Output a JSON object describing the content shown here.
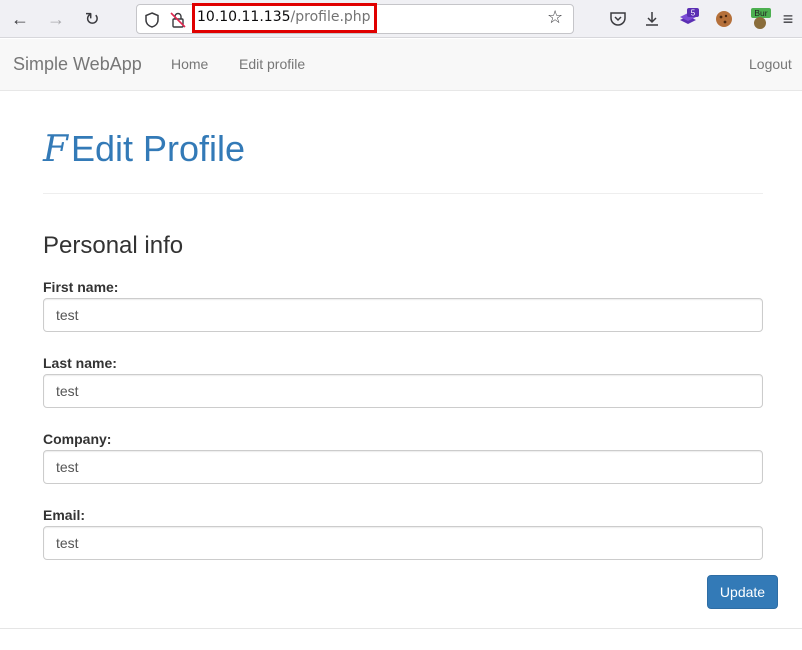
{
  "browser": {
    "back_label": "←",
    "forward_label": "→",
    "reload_label": "↻",
    "url_host": "10.10.11.135",
    "url_path": "/profile.php",
    "bookmark_star": "☆",
    "extension_badge": "5",
    "burp_label": "Bur",
    "menu_label": "≡"
  },
  "navbar": {
    "brand": "Simple WebApp",
    "links": [
      "Home",
      "Edit profile"
    ],
    "logout": "Logout"
  },
  "page": {
    "title_glyph": "F",
    "title": "Edit Profile",
    "section": "Personal info",
    "fields": [
      {
        "label": "First name:",
        "value": "test"
      },
      {
        "label": "Last name:",
        "value": "test"
      },
      {
        "label": "Company:",
        "value": "test"
      },
      {
        "label": "Email:",
        "value": "test"
      }
    ],
    "submit": "Update"
  },
  "colors": {
    "accent": "#337ab7",
    "url_highlight": "#e00000"
  }
}
